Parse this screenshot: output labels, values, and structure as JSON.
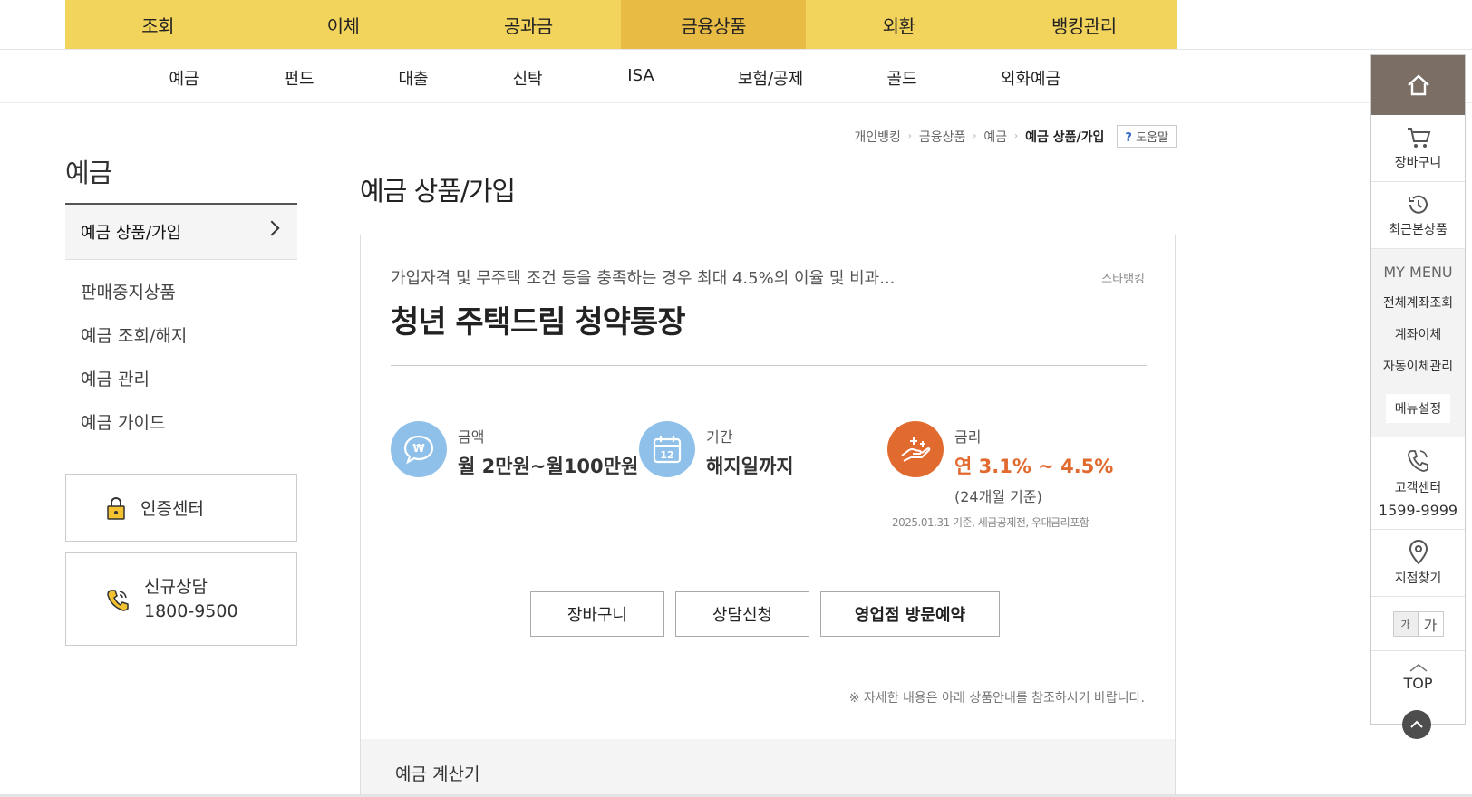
{
  "topnav": [
    "조회",
    "이체",
    "공과금",
    "금융상품",
    "외환",
    "뱅킹관리"
  ],
  "subnav": [
    "예금",
    "펀드",
    "대출",
    "신탁",
    "ISA",
    "보험/공제",
    "골드",
    "외화예금"
  ],
  "breadcrumb": {
    "items": [
      "개인뱅킹",
      "금융상품",
      "예금"
    ],
    "current": "예금 상품/가입",
    "help_q": "?",
    "help": "도움말"
  },
  "lnb": {
    "title": "예금",
    "active": "예금 상품/가입",
    "items": [
      "판매중지상품",
      "예금 조회/해지",
      "예금 관리",
      "예금 가이드"
    ],
    "cert": "인증센터",
    "consult_label": "신규상담",
    "consult_phone": "1800-9500"
  },
  "page_title": "예금 상품/가입",
  "product": {
    "description": "가입자격 및 무주택 조건 등을 충족하는 경우 최대 4.5%의 이율 및 비과...",
    "tag": "스타뱅킹",
    "name": "청년 주택드림 청약통장",
    "amount_label": "금액",
    "amount_value": "월 2만원~월100만원",
    "period_label": "기간",
    "period_value": "해지일까지",
    "rate_label": "금리",
    "rate_value": "연 3.1% ~ 4.5%",
    "rate_sub": "(24개월 기준)",
    "base_note": "2025.01.31 기준, 세금공제전, 우대금리포함",
    "btn_cart": "장바구니",
    "btn_consult": "상담신청",
    "btn_visit": "영업점 방문예약",
    "footnote": "※ 자세한 내용은 아래 상품안내를 참조하시기 바랍니다.",
    "calc": "예금 계산기"
  },
  "quick": {
    "cart": "장바구니",
    "recent": "최근본상품",
    "my_menu_title": "MY MENU",
    "my_menu": [
      "전체계좌조회",
      "계좌이체",
      "자동이체관리"
    ],
    "menu_setting": "메뉴설정",
    "cs_label": "고객센터",
    "cs_phone": "1599-9999",
    "branch": "지점찾기",
    "font_small": "가",
    "font_large": "가",
    "top": "TOP"
  },
  "colors": {
    "nav_bg": "#f2d35b",
    "nav_active": "#e8bb44",
    "rate_orange": "#e16a2f",
    "icon_blue": "#8ec0ea"
  },
  "icons": [
    "won-chat-icon",
    "calendar-icon",
    "hand-sparkle-icon",
    "lock-icon",
    "phone-icon",
    "home-icon",
    "cart-icon",
    "history-icon",
    "map-pin-icon",
    "chevron-up-icon"
  ]
}
